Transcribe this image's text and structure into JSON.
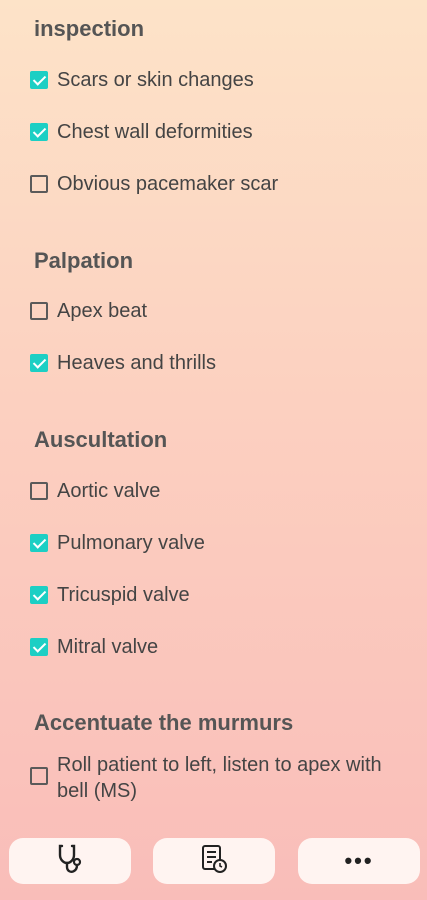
{
  "sections": [
    {
      "title": "inspection",
      "items": [
        {
          "label": "Scars or skin changes",
          "checked": true
        },
        {
          "label": "Chest wall deformities",
          "checked": true
        },
        {
          "label": "Obvious pacemaker scar",
          "checked": false
        }
      ]
    },
    {
      "title": "Palpation",
      "items": [
        {
          "label": "Apex beat",
          "checked": false
        },
        {
          "label": "Heaves and thrills",
          "checked": true
        }
      ]
    },
    {
      "title": "Auscultation",
      "items": [
        {
          "label": "Aortic valve",
          "checked": false
        },
        {
          "label": "Pulmonary valve",
          "checked": true
        },
        {
          "label": "Tricuspid valve",
          "checked": true
        },
        {
          "label": "Mitral valve",
          "checked": true
        }
      ]
    },
    {
      "title": "Accentuate the murmurs",
      "items": [
        {
          "label": "Roll patient to left, listen to apex with bell (MS)",
          "checked": false
        }
      ]
    }
  ],
  "bottom_nav": [
    {
      "icon": "stethoscope-icon"
    },
    {
      "icon": "checklist-timer-icon"
    },
    {
      "icon": "more-icon",
      "label": "•••"
    }
  ],
  "colors": {
    "check": "#1ccfc4"
  }
}
